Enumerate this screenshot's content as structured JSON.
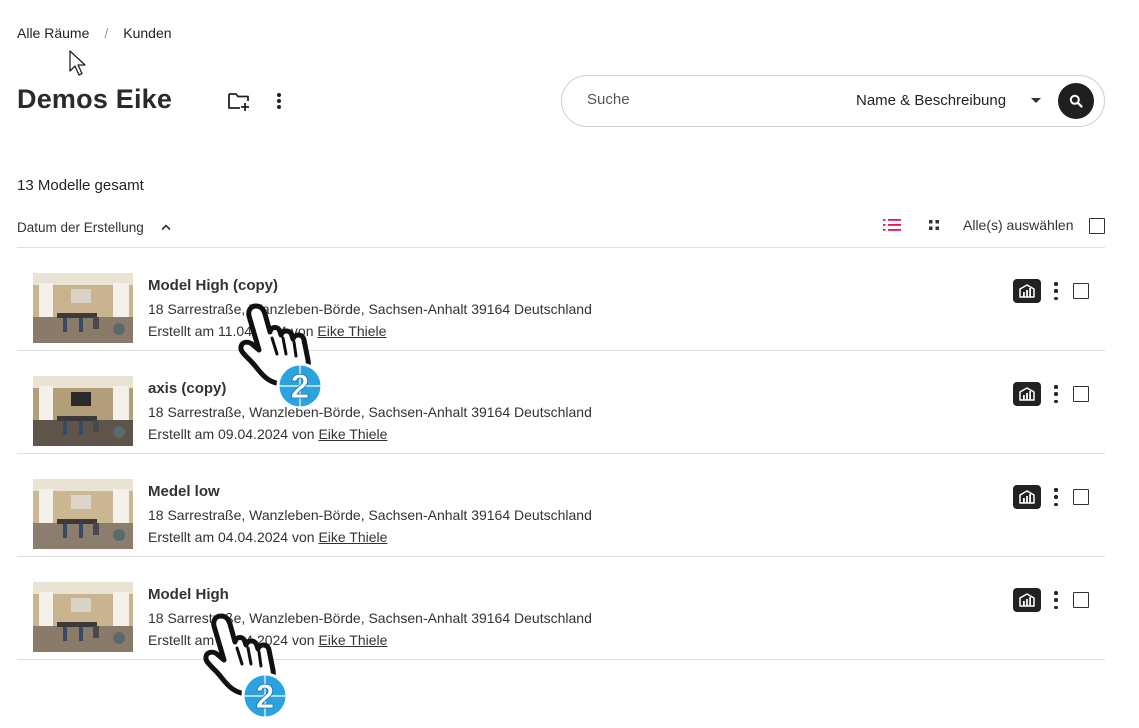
{
  "breadcrumb": {
    "items": [
      "Alle Räume",
      "Kunden"
    ],
    "separator": "/"
  },
  "header": {
    "title": "Demos Eike"
  },
  "search": {
    "placeholder": "Suche",
    "scope": "Name & Beschreibung"
  },
  "list": {
    "count_text": "13 Modelle gesamt",
    "sort_label": "Datum der Erstellung",
    "select_all_label": "Alle(s) auswählen",
    "items": [
      {
        "title": "Model High (copy)",
        "address": "18 Sarrestraße, Wanzleben-Börde, Sachsen-Anhalt 39164 Deutschland",
        "created_prefix": "Erstellt am 11.04.2024 von ",
        "author": "Eike Thiele"
      },
      {
        "title": "axis (copy)",
        "address": "18 Sarrestraße, Wanzleben-Börde, Sachsen-Anhalt 39164 Deutschland",
        "created_prefix": "Erstellt am 09.04.2024 von ",
        "author": "Eike Thiele"
      },
      {
        "title": "Medel low",
        "address": "18 Sarrestraße, Wanzleben-Börde, Sachsen-Anhalt 39164 Deutschland",
        "created_prefix": "Erstellt am 04.04.2024 von ",
        "author": "Eike Thiele"
      },
      {
        "title": "Model High",
        "address": "18 Sarrestraße, Wanzleben-Börde, Sachsen-Anhalt 39164 Deutschland",
        "created_prefix": "Erstellt am 04.04.2024 von ",
        "author": "Eike Thiele"
      }
    ]
  },
  "overlay": {
    "tap_count": "2"
  },
  "icons": {
    "folder_add": "folder-add-icon",
    "more": "more-vertical-icon",
    "search": "search-icon",
    "dropdown": "caret-down-icon",
    "sort": "chevron-up-icon",
    "list_view": "list-view-icon",
    "grid_view": "grid-view-icon",
    "model_badge": "building-chart-icon"
  },
  "colors": {
    "accent": "#e8174e",
    "dark": "#222222",
    "tap_blue": "#2aa3e0"
  }
}
